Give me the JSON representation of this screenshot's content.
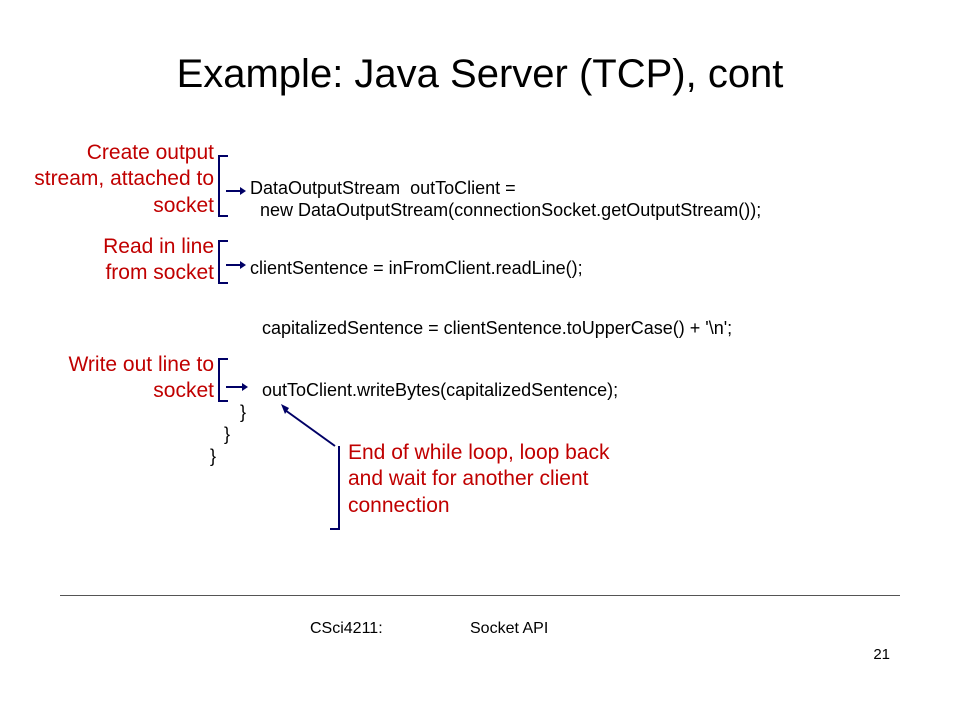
{
  "title": "Example: Java Server (TCP), cont",
  "annotations": {
    "output": "Create output\nstream, attached\nto socket",
    "read": "Read in  line\nfrom socket",
    "write": "Write out line\nto socket",
    "loop": "End of while loop,\nloop back and wait for\nanother client connection"
  },
  "code": {
    "l1": "DataOutputStream  outToClient =",
    "l2": "  new DataOutputStream(connectionSocket.getOutputStream());",
    "l3": "clientSentence = inFromClient.readLine();",
    "l4": "capitalizedSentence = clientSentence.toUpperCase() + '\\n';",
    "l5": "outToClient.writeBytes(capitalizedSentence);",
    "b1": "}",
    "b2": "}",
    "b3": "}"
  },
  "footer": {
    "course": "CSci4211:",
    "topic": "Socket API",
    "page": "21"
  }
}
